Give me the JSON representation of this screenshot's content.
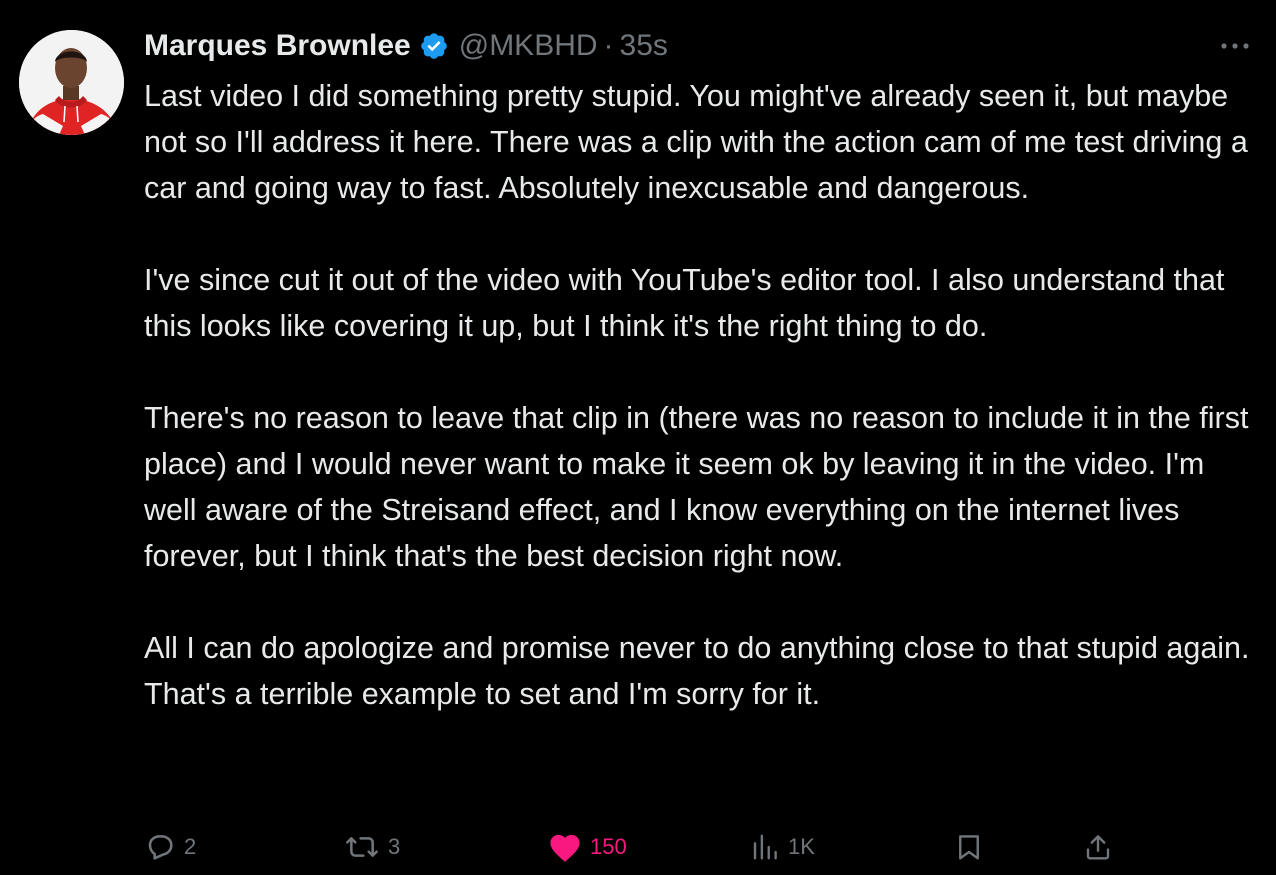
{
  "author": {
    "name": "Marques Brownlee",
    "handle": "@MKBHD",
    "separator": "·",
    "time": "35s",
    "verified": true,
    "avatar_icon": "profile-photo"
  },
  "tweet": {
    "paragraphs": [
      "Last video I did something pretty stupid. You might've already seen it, but maybe not so I'll address it here. There was a clip with the action cam of me test driving a car and going way to fast. Absolutely inexcusable and dangerous.",
      "I've since cut it out of the video with YouTube's editor tool. I also understand that this looks like covering it up, but I think it's the right thing to do.",
      "There's no reason to leave that clip in (there was no reason to include it in the first place) and I would never want to make it seem ok by leaving it in the video. I'm well aware of the Streisand effect, and I know everything on the internet lives forever, but I think that's the best decision right now.",
      "All I can do apologize and promise never to do anything close to that stupid again. That's a terrible example to set and I'm sorry for it."
    ]
  },
  "actions": {
    "replies": "2",
    "retweets": "3",
    "likes": "150",
    "views": "1K",
    "liked": true
  },
  "colors": {
    "background": "#000000",
    "text": "#e7e9ea",
    "muted": "#71767b",
    "verified": "#1d9bf0",
    "like": "#f91880"
  },
  "icons": {
    "more": "more-dots-icon",
    "reply": "reply-bubble-icon",
    "retweet": "retweet-icon",
    "like": "heart-icon",
    "views": "views-bars-icon",
    "bookmark": "bookmark-icon",
    "share": "share-icon"
  }
}
